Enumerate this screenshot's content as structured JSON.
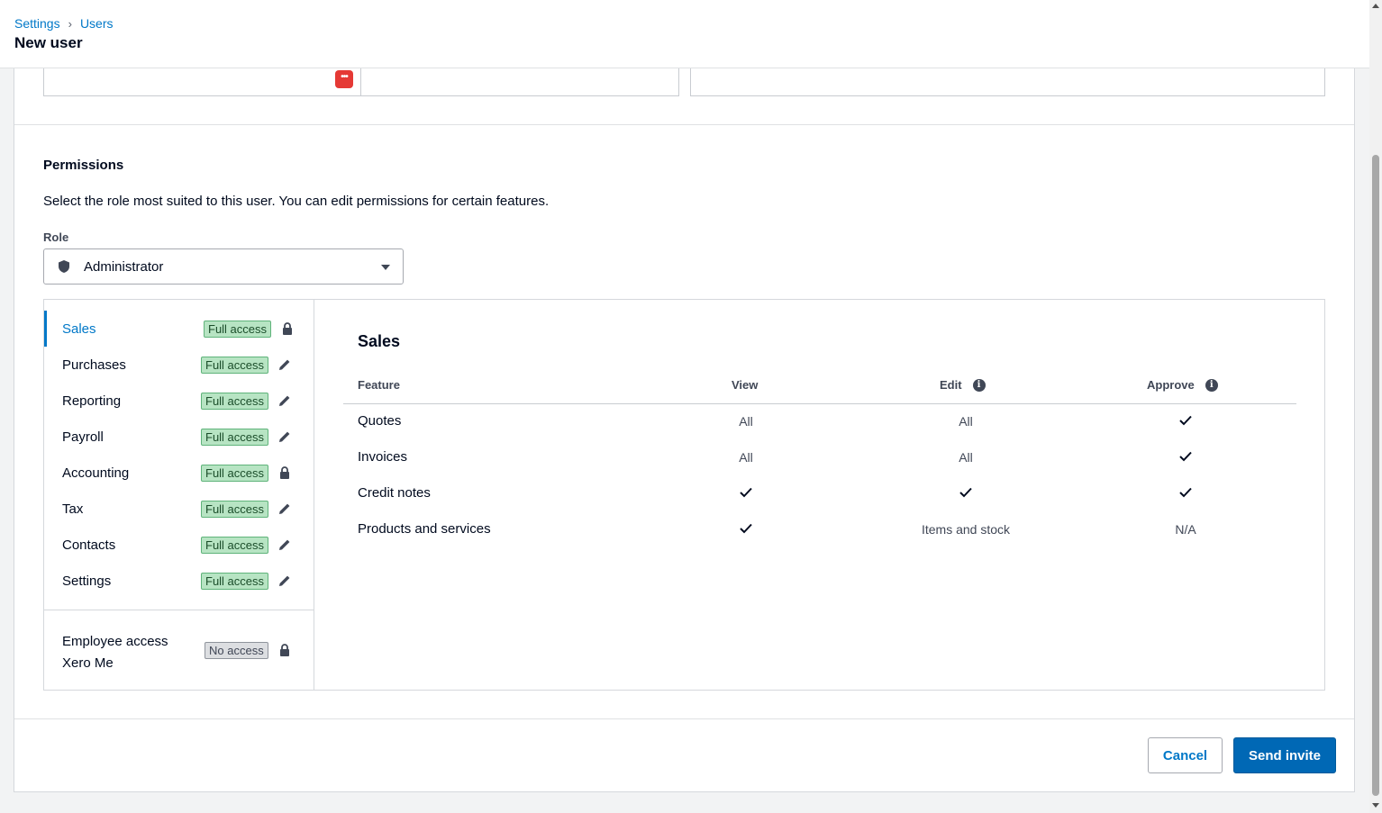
{
  "header": {
    "breadcrumbs": [
      "Settings",
      "Users"
    ],
    "title": "New user"
  },
  "permissions": {
    "title": "Permissions",
    "description": "Select the role most suited to this user. You can edit permissions for certain features.",
    "role_label": "Role",
    "role_value": "Administrator",
    "sidebar": [
      {
        "name": "Sales",
        "badge": "Full access",
        "icon": "lock-icon",
        "active": true
      },
      {
        "name": "Purchases",
        "badge": "Full access",
        "icon": "pencil-icon"
      },
      {
        "name": "Reporting",
        "badge": "Full access",
        "icon": "pencil-icon"
      },
      {
        "name": "Payroll",
        "badge": "Full access",
        "icon": "pencil-icon"
      },
      {
        "name": "Accounting",
        "badge": "Full access",
        "icon": "lock-icon"
      },
      {
        "name": "Tax",
        "badge": "Full access",
        "icon": "pencil-icon"
      },
      {
        "name": "Contacts",
        "badge": "Full access",
        "icon": "pencil-icon"
      },
      {
        "name": "Settings",
        "badge": "Full access",
        "icon": "pencil-icon"
      }
    ],
    "employee": {
      "line1": "Employee access",
      "line2": "Xero Me",
      "badge": "No access",
      "icon": "lock-icon"
    },
    "detail": {
      "title": "Sales",
      "columns": [
        "Feature",
        "View",
        "Edit",
        "Approve"
      ],
      "rows": [
        {
          "feature": "Quotes",
          "view": "All",
          "edit": "All",
          "approve": "check"
        },
        {
          "feature": "Invoices",
          "view": "All",
          "edit": "All",
          "approve": "check"
        },
        {
          "feature": "Credit notes",
          "view": "check",
          "edit": "check",
          "approve": "check"
        },
        {
          "feature": "Products and services",
          "view": "check",
          "edit": "Items and stock",
          "approve": "N/A"
        }
      ]
    }
  },
  "footer": {
    "cancel_label": "Cancel",
    "send_label": "Send invite"
  },
  "colors": {
    "accent": "#0078c8",
    "primary_button": "#0068b5",
    "full_access_badge": "#b7e4c3",
    "no_access_badge": "#dcdee1"
  }
}
